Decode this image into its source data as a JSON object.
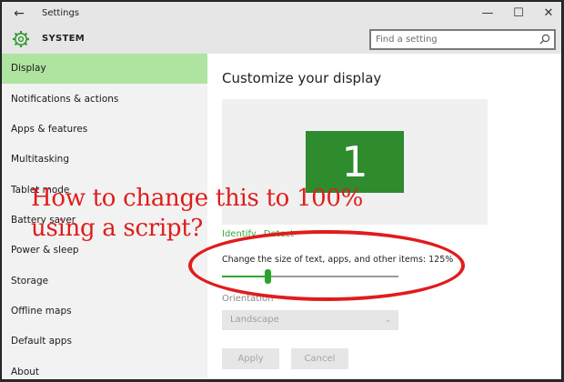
{
  "window": {
    "title": "Settings",
    "back_glyph": "←",
    "minimize_glyph": "—",
    "maximize_glyph": "☐",
    "close_glyph": "✕"
  },
  "header": {
    "section_title": "SYSTEM",
    "section_icon": "gear-icon",
    "search_placeholder": "Find a setting"
  },
  "sidebar": {
    "items": [
      {
        "label": "Display",
        "active": true
      },
      {
        "label": "Notifications & actions"
      },
      {
        "label": "Apps & features"
      },
      {
        "label": "Multitasking"
      },
      {
        "label": "Tablet mode"
      },
      {
        "label": "Battery saver"
      },
      {
        "label": "Power & sleep"
      },
      {
        "label": "Storage"
      },
      {
        "label": "Offline maps"
      },
      {
        "label": "Default apps"
      },
      {
        "label": "About"
      }
    ]
  },
  "main": {
    "title": "Customize your display",
    "monitor_number": "1",
    "identify_label": "Identify",
    "detect_label": "Detect",
    "scale_label": "Change the size of text, apps, and other items: 125%",
    "scale_slider_fraction": 0.25,
    "orientation_label": "Orientation",
    "orientation_value": "Landscape",
    "apply_label": "Apply",
    "cancel_label": "Cancel"
  },
  "annotation": {
    "line1": "How to change this to 100%",
    "line2": "using a script?"
  },
  "colors": {
    "accent_green": "#31a331",
    "active_nav": "#aee3a0",
    "annotation_red": "#e01c1c"
  }
}
